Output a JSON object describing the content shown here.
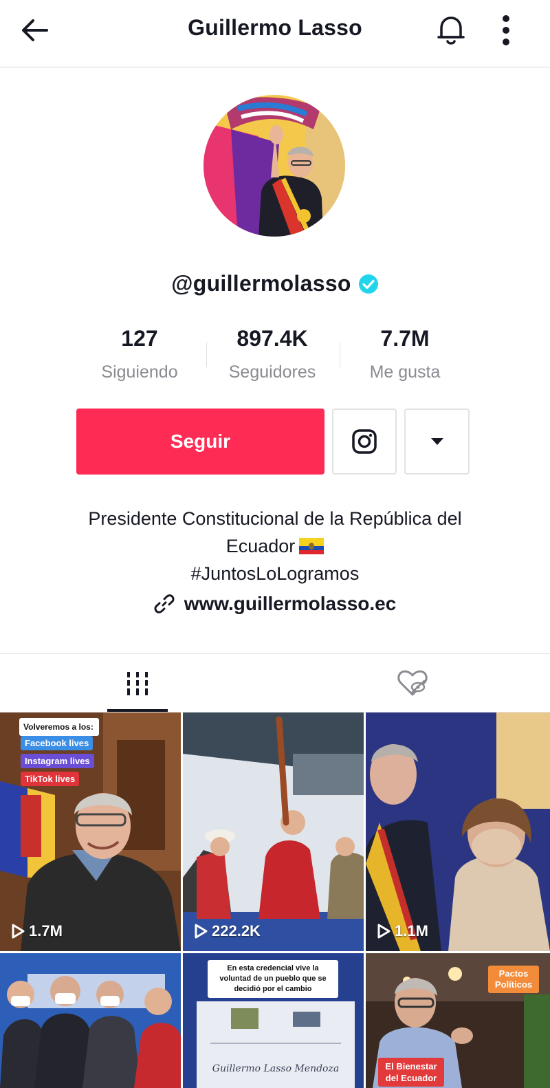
{
  "header": {
    "title": "Guillermo Lasso",
    "icons": {
      "back": "arrow-left-icon",
      "notifications": "bell-icon",
      "more": "more-vertical-icon"
    }
  },
  "profile": {
    "username": "@guillermolasso",
    "verified": true,
    "avatar_icon": "profile-photo"
  },
  "stats": [
    {
      "value": "127",
      "label": "Siguiendo"
    },
    {
      "value": "897.4K",
      "label": "Seguidores"
    },
    {
      "value": "7.7M",
      "label": "Me gusta"
    }
  ],
  "actions": {
    "follow_label": "Seguir",
    "follow_color": "#fe2c55",
    "instagram_icon": "instagram-icon",
    "dropdown_icon": "caret-down-icon"
  },
  "bio": {
    "line1": "Presidente Constitucional de la República del",
    "line2": "Ecuador",
    "line3": "#JuntosLoLogramos",
    "flag_icon": "ecuador-flag",
    "link": "www.guillermolasso.ec",
    "link_icon": "link-icon"
  },
  "tabs": {
    "videos_icon": "video-grid-icon",
    "liked_icon": "liked-hidden-icon"
  },
  "videos": [
    {
      "views": "1.7M",
      "overlay_title": "Volveremos a los:",
      "overlay_tags": [
        {
          "text": "Facebook lives",
          "color": "#3b8ee6"
        },
        {
          "text": "Instagram lives",
          "color": "#6a4fd6"
        },
        {
          "text": "TikTok lives",
          "color": "#e0333a"
        }
      ]
    },
    {
      "views": "222.2K"
    },
    {
      "views": "1.1M"
    },
    {
      "views": ""
    },
    {
      "views": "",
      "overlay_note": "En esta credencial vive la voluntad de un pueblo que se decidió por el cambio",
      "document_name": "Guillermo Lasso Mendoza"
    },
    {
      "views": "",
      "overlay_top": "Pactos Políticos",
      "overlay_bottom": "El Bienestar del Ecuador"
    }
  ]
}
